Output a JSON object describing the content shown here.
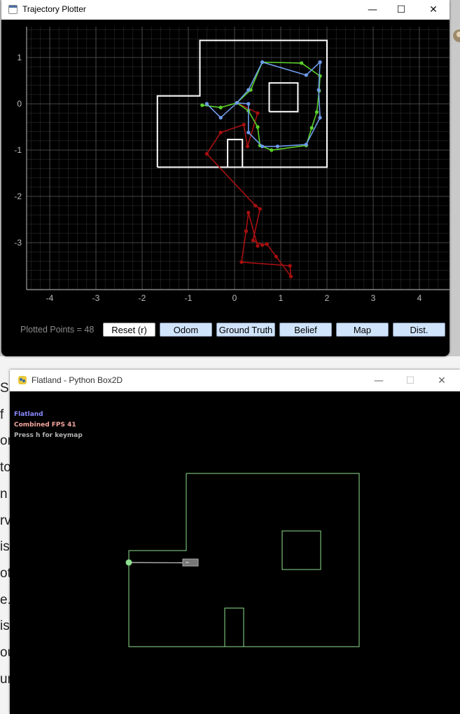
{
  "plotter": {
    "title": "Trajectory Plotter",
    "controls": {
      "minimize": "—",
      "maximize": "☐",
      "close": "✕"
    },
    "plotted_points_label": "Plotted Points = 48",
    "buttons": {
      "reset": "Reset (r)",
      "odom": "Odom",
      "ground_truth": "Ground Truth",
      "belief": "Belief",
      "map": "Map",
      "dist": "Dist."
    },
    "colors": {
      "ground_truth": "#5bd12a",
      "belief": "#6f9bea",
      "odom": "#a80f0f",
      "map": "#ffffff"
    }
  },
  "chart_data": {
    "type": "line",
    "xlim": [
      -4.5,
      4.6
    ],
    "ylim": [
      -4,
      1.6
    ],
    "x_ticks": [
      "-4",
      "-3",
      "-2",
      "-1",
      "0",
      "1",
      "2",
      "3",
      "4"
    ],
    "y_ticks": [
      "1",
      "0",
      "-1",
      "-2",
      "-3"
    ],
    "grid": true,
    "map_outline": [
      [
        -1.67,
        -1.37
      ],
      [
        2.0,
        -1.37
      ],
      [
        2.0,
        1.37
      ],
      [
        -0.75,
        1.37
      ],
      [
        -0.75,
        0.17
      ],
      [
        -1.67,
        0.17
      ],
      [
        -1.67,
        -1.37
      ]
    ],
    "map_box": [
      [
        0.75,
        -0.17
      ],
      [
        1.37,
        -0.17
      ],
      [
        1.37,
        0.45
      ],
      [
        0.75,
        0.45
      ],
      [
        0.75,
        -0.17
      ]
    ],
    "map_door": [
      [
        -0.15,
        -1.37
      ],
      [
        -0.15,
        -0.77
      ],
      [
        0.17,
        -0.77
      ],
      [
        0.17,
        -1.37
      ]
    ],
    "series": [
      {
        "color": "#5bd12a",
        "values": [
          [
            -0.7,
            -0.03
          ],
          [
            -0.3,
            -0.08
          ],
          [
            0.05,
            0.02
          ],
          [
            0.35,
            0.3
          ],
          [
            0.6,
            0.9
          ],
          [
            1.45,
            0.88
          ],
          [
            1.85,
            0.6
          ],
          [
            1.83,
            0.28
          ],
          [
            1.78,
            -0.18
          ],
          [
            1.67,
            -0.52
          ],
          [
            1.55,
            -0.9
          ],
          [
            0.8,
            -1.0
          ],
          [
            0.55,
            -0.9
          ],
          [
            0.5,
            -0.5
          ],
          [
            0.3,
            -0.15
          ],
          [
            0.05,
            0.02
          ]
        ]
      },
      {
        "color": "#6f9bea",
        "values": [
          [
            -0.6,
            0.0
          ],
          [
            -0.3,
            -0.3
          ],
          [
            0.05,
            0.02
          ],
          [
            0.3,
            0.3
          ],
          [
            0.6,
            0.9
          ],
          [
            1.55,
            0.62
          ],
          [
            1.85,
            0.9
          ],
          [
            1.82,
            0.3
          ],
          [
            1.85,
            -0.3
          ],
          [
            1.55,
            -0.88
          ],
          [
            0.93,
            -0.92
          ],
          [
            0.6,
            -0.92
          ],
          [
            0.3,
            -0.62
          ],
          [
            0.3,
            0.0
          ],
          [
            0.05,
            0.02
          ]
        ]
      },
      {
        "color": "#a80f0f",
        "values": [
          [
            0.05,
            0.02
          ],
          [
            0.5,
            -0.2
          ],
          [
            0.28,
            -0.92
          ],
          [
            0.2,
            -0.45
          ],
          [
            -0.3,
            -0.62
          ],
          [
            -0.6,
            -1.08
          ],
          [
            0.45,
            -2.2
          ],
          [
            0.55,
            -2.27
          ],
          [
            0.4,
            -2.95
          ],
          [
            0.6,
            -3.05
          ],
          [
            0.7,
            -3.03
          ],
          [
            0.9,
            -3.3
          ],
          [
            1.22,
            -3.73
          ],
          [
            1.2,
            -3.5
          ],
          [
            0.15,
            -3.42
          ],
          [
            0.25,
            -2.75
          ],
          [
            0.3,
            -2.35
          ],
          [
            0.5,
            -3.07
          ]
        ]
      }
    ]
  },
  "flatland": {
    "title": "Flatland - Python Box2D",
    "controls": {
      "minimize": "—",
      "maximize": "☐",
      "close": "✕"
    },
    "hud": {
      "name": "Flatland",
      "fps": "Combined FPS 41",
      "help": "Press h for keymap"
    },
    "hud_colors": {
      "name": "#8a8aff",
      "fps": "#f4a6a0",
      "help": "#b4b4b4"
    },
    "wall_color": "#8ee08e",
    "robot_color": "#8ee08e",
    "laser_color": "#d0d0d0"
  },
  "background_text": [
    "S",
    "f",
    "or",
    "to",
    "n",
    "rv",
    "is",
    "ot",
    "e.",
    "is",
    "ou",
    "ur"
  ]
}
